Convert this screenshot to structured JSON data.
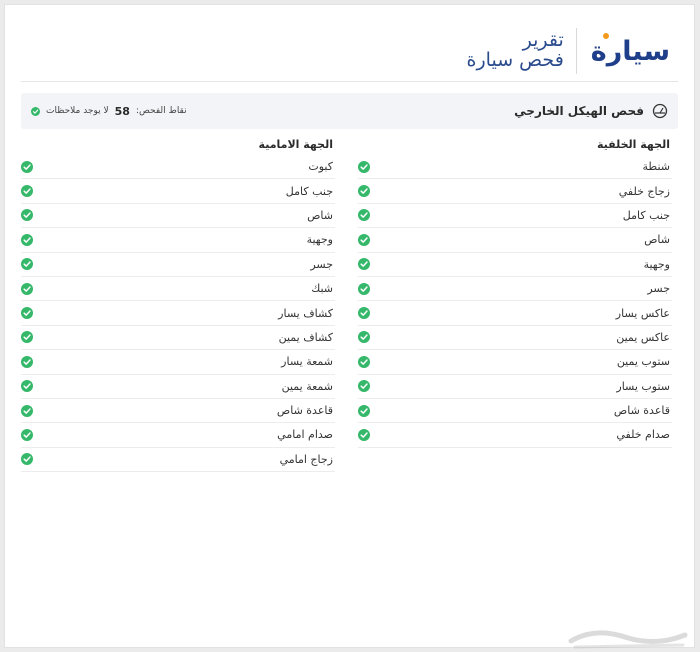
{
  "brand": {
    "logo_text": "سيارة",
    "accent": "#f39a1e",
    "primary": "#1f3f8a"
  },
  "report": {
    "line1": "تقرير",
    "line2": "فحص سيارة"
  },
  "section": {
    "title": "فحص الهيكل الخارجي",
    "icon": "inspection-gauge-icon",
    "points_label": "نقاط الفحص:",
    "points_value": "58",
    "status_text": "لا يوجد ملاحظات",
    "status_color": "#35b86a"
  },
  "rear": {
    "heading": "الجهة الخلفية",
    "items": [
      "شنطة",
      "زجاج خلفي",
      "جنب كامل",
      "شاص",
      "وجهية",
      "جسر",
      "عاكس يسار",
      "عاكس يمين",
      "ستوب يمين",
      "ستوب يسار",
      "قاعدة شاص",
      "صدام خلفي"
    ]
  },
  "front": {
    "heading": "الجهة الامامية",
    "items": [
      "كبوت",
      "جنب كامل",
      "شاص",
      "وجهية",
      "جسر",
      "شبك",
      "كشاف يسار",
      "كشاف يمين",
      "شمعة يسار",
      "شمعة يمين",
      "قاعدة شاص",
      "صدام امامي",
      "زجاج امامي"
    ]
  }
}
